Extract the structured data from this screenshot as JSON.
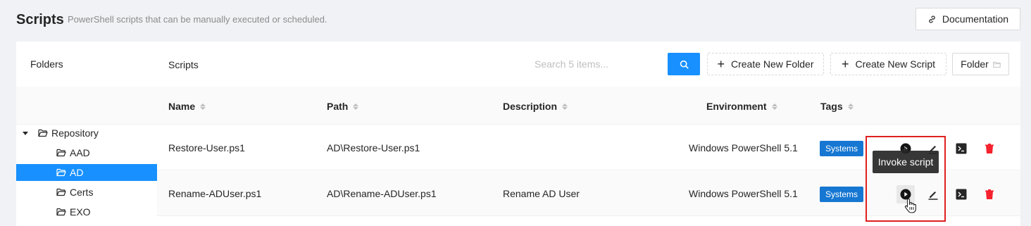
{
  "header": {
    "title": "Scripts",
    "subtitle": "PowerShell scripts that can be manually executed or scheduled.",
    "documentation_label": "Documentation"
  },
  "folders_panel": {
    "heading": "Folders",
    "tree": [
      {
        "label": "Repository",
        "expanded": true,
        "selected": false
      },
      {
        "label": "AAD",
        "selected": false
      },
      {
        "label": "AD",
        "selected": true
      },
      {
        "label": "Certs",
        "selected": false
      },
      {
        "label": "EXO",
        "selected": false
      }
    ]
  },
  "scripts_panel": {
    "heading": "Scripts",
    "search": {
      "placeholder": "Search 5 items..."
    },
    "create_folder_label": "Create New Folder",
    "create_script_label": "Create New Script",
    "folder_label": "Folder",
    "columns": [
      "Name",
      "Path",
      "Description",
      "Environment",
      "Tags"
    ],
    "rows": [
      {
        "name": "Restore-User.ps1",
        "path": "AD\\Restore-User.ps1",
        "description": "",
        "environment": "Windows PowerShell 5.1",
        "tag": "Systems"
      },
      {
        "name": "Rename-ADUser.ps1",
        "path": "AD\\Rename-ADUser.ps1",
        "description": "Rename AD User",
        "environment": "Windows PowerShell 5.1",
        "tag": "Systems"
      }
    ]
  },
  "tooltip": {
    "text": "Invoke script"
  },
  "colors": {
    "primary": "#1890ff",
    "tag": "#1677d2",
    "danger": "#f5222d",
    "highlight": "#e02020"
  },
  "icons": [
    "link-icon",
    "search-icon",
    "plus-icon",
    "folder-icon",
    "sort-icon",
    "play-icon",
    "edit-icon",
    "terminal-icon",
    "delete-icon",
    "cursor-hand-icon"
  ]
}
